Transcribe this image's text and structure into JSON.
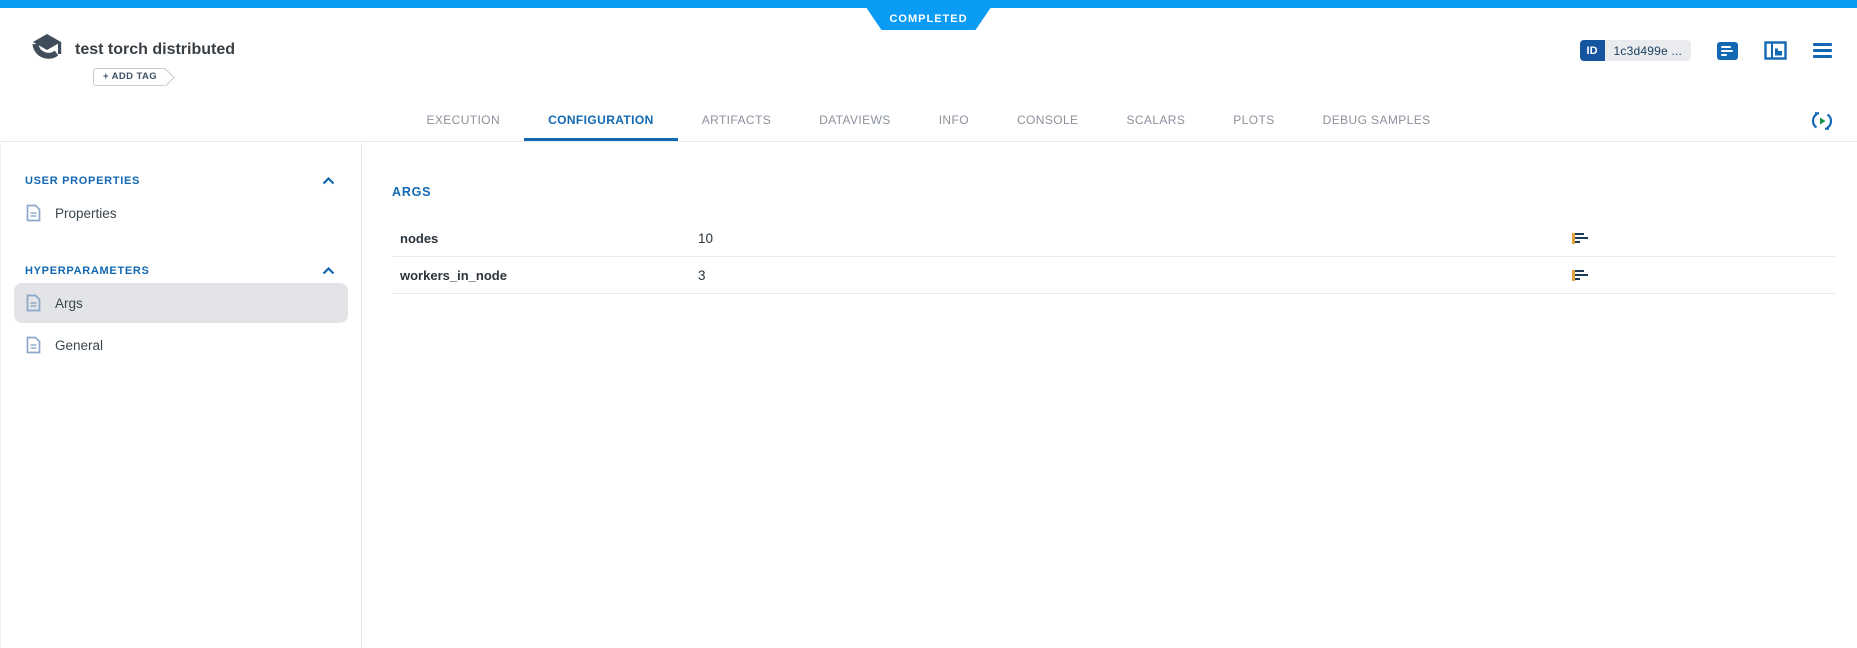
{
  "status_banner": {
    "label": "COMPLETED"
  },
  "colors": {
    "accent_blue": "#0a9bf5",
    "primary_blue": "#1268b3",
    "id_chip_blue": "#15549f",
    "tab_gray": "#8a929c",
    "selected_item_bg": "#e2e4e8",
    "row_icon_navy": "#1f3a54",
    "row_icon_orange": "#e2a33c",
    "refresh_play_green": "#149144"
  },
  "header": {
    "title": "test torch distributed",
    "add_tag_label": "+ ADD TAG",
    "id_badge": {
      "label": "ID",
      "value": "1c3d499e ..."
    },
    "tabs": [
      {
        "label": "EXECUTION",
        "active": false
      },
      {
        "label": "CONFIGURATION",
        "active": true
      },
      {
        "label": "ARTIFACTS",
        "active": false
      },
      {
        "label": "DATAVIEWS",
        "active": false
      },
      {
        "label": "INFO",
        "active": false
      },
      {
        "label": "CONSOLE",
        "active": false
      },
      {
        "label": "SCALARS",
        "active": false
      },
      {
        "label": "PLOTS",
        "active": false
      },
      {
        "label": "DEBUG SAMPLES",
        "active": false
      }
    ],
    "icons": {
      "logo": "task-logo-icon",
      "notes": "notes-panel-icon",
      "layout": "layout-panel-icon",
      "menu": "hamburger-menu-icon",
      "refresh": "auto-refresh-icon"
    }
  },
  "sidebar": {
    "sections": [
      {
        "title": "USER PROPERTIES",
        "items": [
          {
            "label": "Properties",
            "selected": false
          }
        ]
      },
      {
        "title": "HYPERPARAMETERS",
        "items": [
          {
            "label": "Args",
            "selected": true
          },
          {
            "label": "General",
            "selected": false
          }
        ]
      }
    ]
  },
  "main": {
    "heading": "ARGS",
    "rows": [
      {
        "name": "nodes",
        "value": "10"
      },
      {
        "name": "workers_in_node",
        "value": "3"
      }
    ]
  }
}
